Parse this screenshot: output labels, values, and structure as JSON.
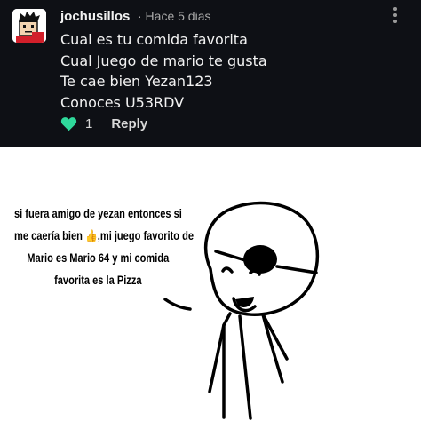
{
  "comment": {
    "username": "jochusillos",
    "meta": "· Hace 5 dias",
    "lines": [
      "Cual es tu comida favorita",
      "Cual Juego de mario te gusta",
      "Te cae bien Yezan123",
      "Conoces U53RDV"
    ],
    "likes": "1",
    "reply_label": "Reply",
    "icons": {
      "like": "heart-icon",
      "menu": "more-vertical-icon",
      "avatar": "avatar-image"
    },
    "colors": {
      "background": "#0e1015",
      "accent": "#2fd99b",
      "meta": "#a9a9a9"
    }
  },
  "comic": {
    "speech_lines": [
      "si fuera amigo de yezan entonces si",
      "me caería bien 👍,mi juego favorito de",
      "Mario es Mario 64 y mi comida",
      "favorita es la Pizza"
    ]
  }
}
